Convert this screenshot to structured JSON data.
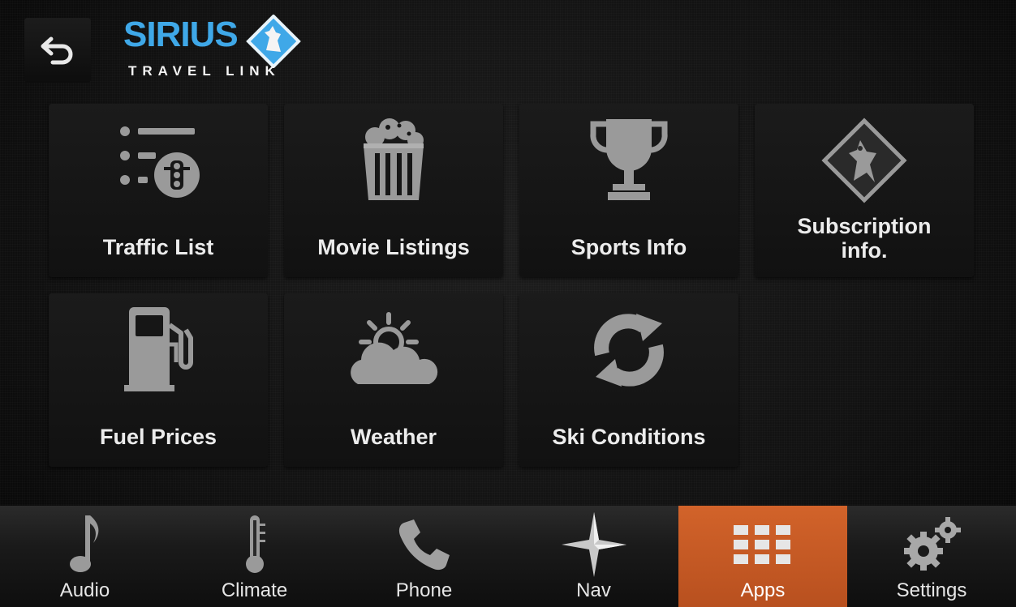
{
  "header": {
    "back_icon": "back-arrow-icon",
    "logo": {
      "brand": "SIRIUS",
      "subtitle": "TRAVEL LINK",
      "icon": "sirius-dog-diamond-icon"
    }
  },
  "tiles": [
    {
      "label": "Traffic List",
      "icon": "traffic-list-icon"
    },
    {
      "label": "Movie Listings",
      "icon": "popcorn-icon"
    },
    {
      "label": "Sports Info",
      "icon": "trophy-icon"
    },
    {
      "label": "Subscription\ninfo.",
      "icon": "sirius-dog-icon"
    },
    {
      "label": "Fuel Prices",
      "icon": "fuel-pump-icon"
    },
    {
      "label": "Weather",
      "icon": "sun-cloud-icon"
    },
    {
      "label": "Ski Conditions",
      "icon": "refresh-icon"
    }
  ],
  "nav": [
    {
      "label": "Audio",
      "icon": "music-note-icon",
      "active": false
    },
    {
      "label": "Climate",
      "icon": "thermometer-icon",
      "active": false
    },
    {
      "label": "Phone",
      "icon": "phone-icon",
      "active": false
    },
    {
      "label": "Nav",
      "icon": "compass-star-icon",
      "active": false
    },
    {
      "label": "Apps",
      "icon": "apps-grid-icon",
      "active": true
    },
    {
      "label": "Settings",
      "icon": "gears-icon",
      "active": false
    }
  ],
  "colors": {
    "accent": "#c95a25",
    "brand_blue": "#3fa8e8",
    "icon_gray": "#8a8a8a"
  }
}
